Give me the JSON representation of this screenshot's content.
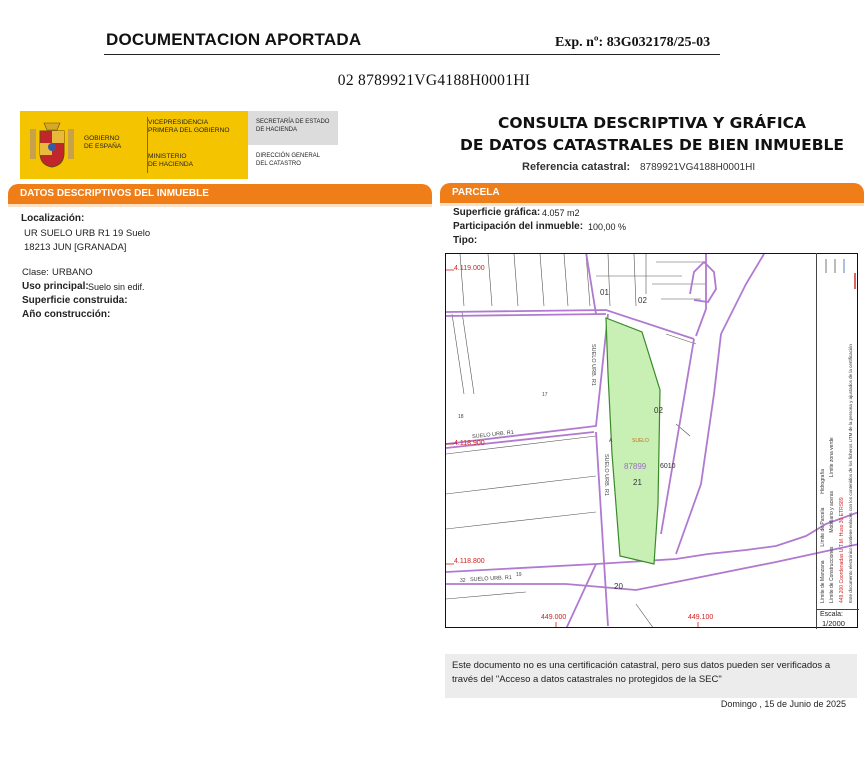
{
  "header": {
    "title": "DOCUMENTACION APORTADA",
    "exp_number": "Exp. nº: 83G032178/25-03",
    "reference_line": "02 8789921VG4188H0001HI"
  },
  "logo": {
    "gobierno": "GOBIERNO\nDE ESPAÑA",
    "vicepresidencia": "VICEPRESIDENCIA\nPRIMERA DEL GOBIERNO",
    "ministerio": "MINISTERIO\nDE HACIENDA",
    "secretaria": "SECRETARÍA DE ESTADO\nDE HACIENDA",
    "direccion": "DIRECCIÓN GENERAL\nDEL CATASTRO",
    "colors": {
      "yellow": "#f5c400",
      "grey": "#dcdcdc"
    }
  },
  "consulta": {
    "title": "CONSULTA DESCRIPTIVA Y GRÁFICA\nDE DATOS CATASTRALES DE BIEN INMUEBLE",
    "ref_label": "Referencia catastral:",
    "ref_value": "8789921VG4188H0001HI"
  },
  "left_panel": {
    "bar_title": "DATOS DESCRIPTIVOS DEL INMUEBLE",
    "localizacion_label": "Localización:",
    "localizacion_line1": "UR SUELO URB R1 19 Suelo",
    "localizacion_line2": "18213 JUN [GRANADA]",
    "clase_label": "Clase:",
    "clase_value": "URBANO",
    "uso_label": "Uso principal:",
    "uso_value": "Suelo sin edif.",
    "superficie_label": "Superficie construida:",
    "anio_label": "Año construcción:"
  },
  "right_panel": {
    "bar_title": "PARCELA",
    "superficie_label": "Superficie gráfica:",
    "superficie_value": "4.057 m2",
    "participacion_label": "Participación del inmueble:",
    "participacion_value": "100,00 %",
    "tipo_label": "Tipo:"
  },
  "map": {
    "coord_y_top": "4.119.000",
    "coord_y_mid": "4.118.900",
    "coord_y_bottom": "4.118.800",
    "coord_x_left": "449.000",
    "coord_x_right": "449.100",
    "street_label_1": "SUELO URB. R1",
    "street_label_2": "SUELO URB. R1",
    "street_label_3": "SUELO URB. R1",
    "street_label_4": "SUELO URB. R1",
    "parcel_label": "87899",
    "parcel_number": "21",
    "label_01": "01",
    "label_02a": "02",
    "label_02b": "02",
    "label_6010": "6010",
    "label_20": "20",
    "label_suelo": "SUELO",
    "label_17": "17",
    "label_18": "18",
    "label_32": "32",
    "label_19": "19",
    "label_a": "A",
    "legend_col1": "Límite de Manzana",
    "legend_col2": "Límite de Parcela",
    "legend_col3": "Hidrografía",
    "legend_col4": "Límite de Construcciones",
    "legend_col5": "Mobiliario y aceras",
    "legend_col6": "Límite zona verde",
    "legend_coords": "449.200 Coordenadas U.T.M. Huso 30 ETRS89",
    "legend_disclaimer": "Este documento electrónico contiene enlaces con los contenidos de los ficheros UTM de la persona y ajustados de la certificación",
    "scale_label": "Escala:",
    "scale_value": "1/2000",
    "colors": {
      "boundary": "#b07ad0",
      "parcel_fill": "#c8f0b4",
      "parcel_stroke": "#3a8a2a",
      "coord_text": "#d02020"
    }
  },
  "notice": {
    "text": "Este documento no es una certificación catastral, pero sus datos pueden ser verificados a través del \"Acceso a datos catastrales no protegidos de la SEC\"",
    "date": "Domingo , 15 de Junio de 2025"
  },
  "colors": {
    "orange": "#ef7d18"
  }
}
